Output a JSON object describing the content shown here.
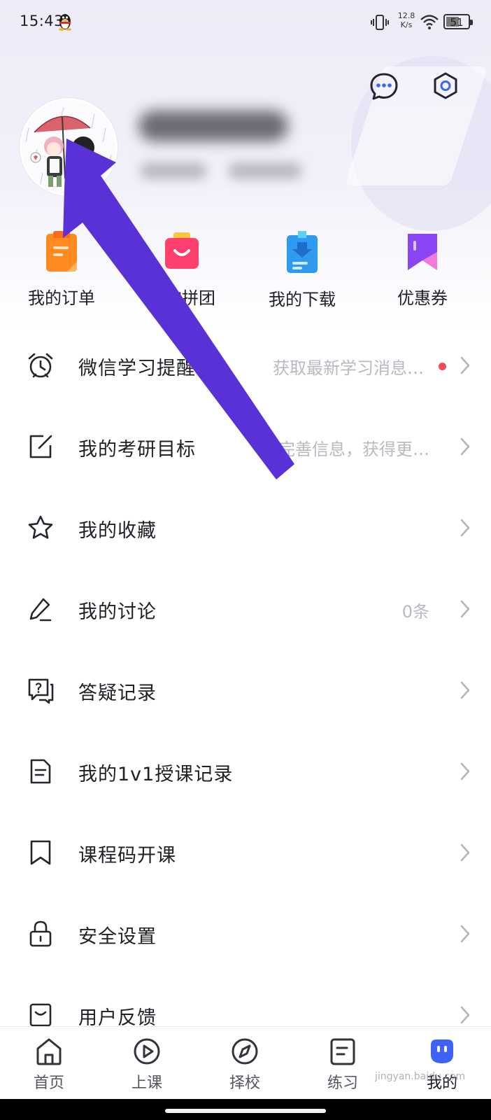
{
  "status_bar": {
    "time": "15:43",
    "net_speed_value": "12.8",
    "net_speed_unit": "K/s",
    "battery_level": "51"
  },
  "header": {
    "message_icon": "chat-bubble-icon",
    "settings_icon": "hexagon-settings-icon"
  },
  "shortcuts": [
    {
      "label": "我的订单",
      "icon": "order-icon",
      "color": "#ff8a1f"
    },
    {
      "label": "我的拼团",
      "icon": "shopping-bag-icon",
      "color": "#ff3f6e"
    },
    {
      "label": "我的下载",
      "icon": "download-icon",
      "color": "#2e9bf0"
    },
    {
      "label": "优惠券",
      "icon": "coupon-icon",
      "color": "#8b45f5"
    }
  ],
  "menu": [
    {
      "label": "微信学习提醒",
      "icon": "alarm-clock-icon",
      "hint": "获取最新学习消息…",
      "dot": true
    },
    {
      "label": "我的考研目标",
      "icon": "edit-square-icon",
      "hint": "完善信息，获得更…",
      "dot": false
    },
    {
      "label": "我的收藏",
      "icon": "star-icon",
      "hint": "",
      "dot": false
    },
    {
      "label": "我的讨论",
      "icon": "pencil-icon",
      "hint": "0条",
      "dot": false
    },
    {
      "label": "答疑记录",
      "icon": "question-chat-icon",
      "hint": "",
      "dot": false
    },
    {
      "label": "我的1v1授课记录",
      "icon": "document-icon",
      "hint": "",
      "dot": false
    },
    {
      "label": "课程码开课",
      "icon": "bookmark-icon",
      "hint": "",
      "dot": false
    },
    {
      "label": "安全设置",
      "icon": "lock-icon",
      "hint": "",
      "dot": false
    },
    {
      "label": "用户反馈",
      "icon": "feedback-icon",
      "hint": "",
      "dot": false
    }
  ],
  "tabs": [
    {
      "label": "首页",
      "icon": "home-icon"
    },
    {
      "label": "上课",
      "icon": "play-icon"
    },
    {
      "label": "择校",
      "icon": "compass-icon"
    },
    {
      "label": "练习",
      "icon": "practice-note-icon"
    },
    {
      "label": "我的",
      "icon": "mascot-icon",
      "active": true
    }
  ],
  "watermark": "jingyan.baidu.com",
  "colors": {
    "accent_purple": "#5a31d6",
    "tab_active": "#3f63f7",
    "red_dot": "#f34a55"
  }
}
